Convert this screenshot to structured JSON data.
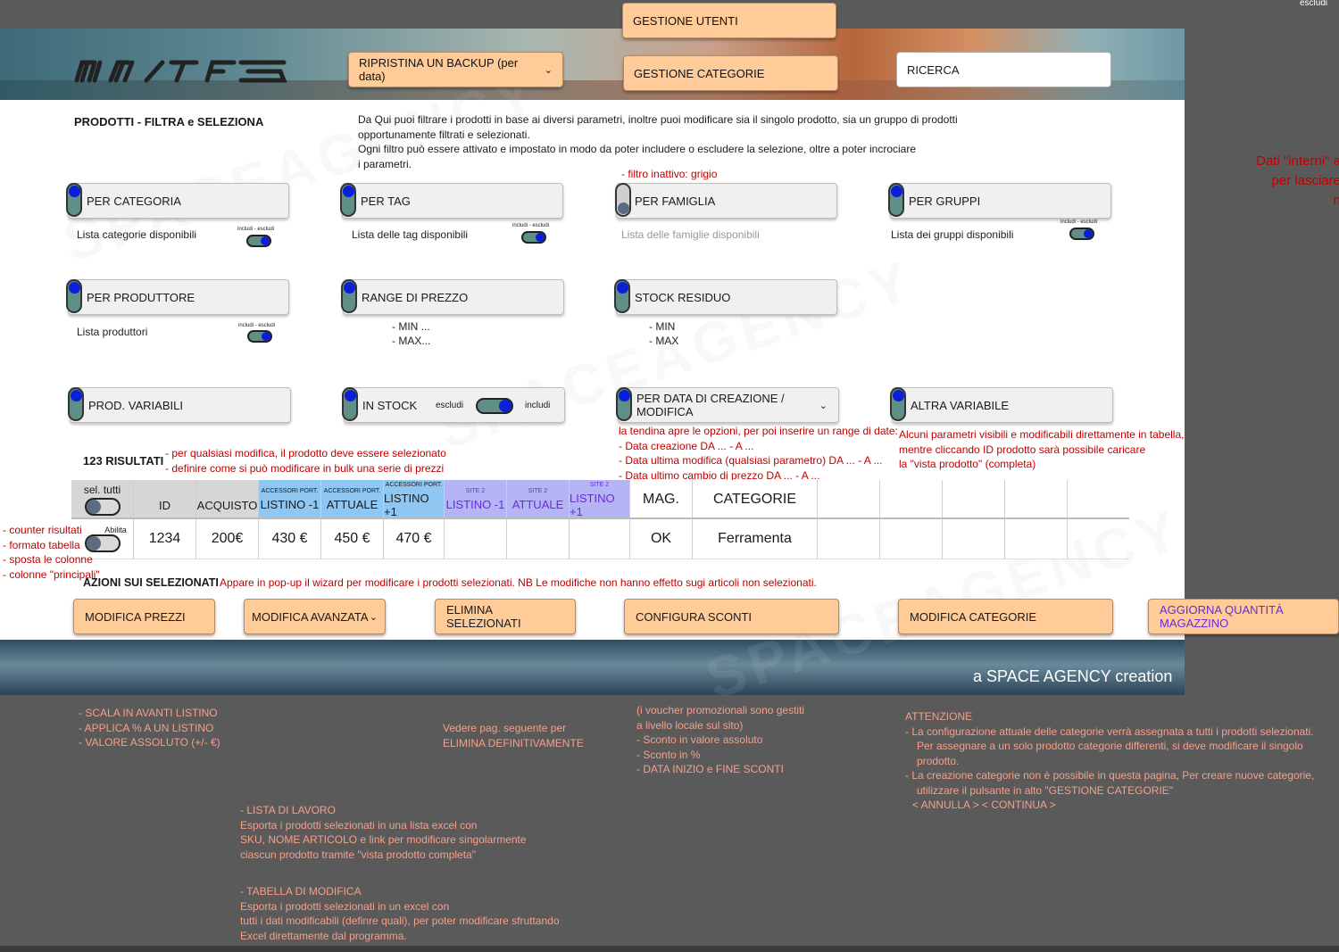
{
  "top_tabs": {
    "gestione_utenti": "GESTIONE UTENTI",
    "ripristina_backup": "RIPRISTINA UN BACKUP (per data)",
    "gestione_categorie": "GESTIONE CATEGORIE",
    "ricerca": "RICERCA"
  },
  "corner": {
    "escludi": "escludi"
  },
  "side_note": {
    "line1": "Dati \"interni\" a",
    "line2": "per lasciare",
    "line3": "n"
  },
  "intro": {
    "title": "PRODOTTI - FILTRA e SELEZIONA",
    "line1": "Da Qui puoi filtrare i prodotti in base ai diversi parametri, inoltre puoi modificare sia il singolo prodotto, sia un gruppo di prodotti",
    "line2": "opportunamente filtrati e selezionati.",
    "line3": "Ogni filtro può essere attivato e impostato in modo da poter includere o escludere la selezione, oltre a poter incrociare",
    "line4": "i parametri."
  },
  "filters": {
    "inactive_note": "filtro inattivo: grigio",
    "include_exclude": "includi - escludi",
    "per_categoria": "PER CATEGORIA",
    "per_categoria_sub": "Lista categorie disponibili",
    "per_tag": "PER TAG",
    "per_tag_sub": "Lista delle tag disponibili",
    "per_famiglia": "PER FAMIGLIA",
    "per_famiglia_sub": "Lista delle famiglie disponibili",
    "per_gruppi": "PER GRUPPI",
    "per_gruppi_sub": "Lista dei gruppi disponibili",
    "per_produttore": "PER PRODUTTORE",
    "per_produttore_sub": "Lista produttori",
    "range_prezzo": "RANGE DI PREZZO",
    "range_min": "MIN ...",
    "range_max": "MAX...",
    "stock_residuo": "STOCK RESIDUO",
    "stock_min": "MIN",
    "stock_max": "MAX",
    "prod_variabili": "PROD. VARIABILI",
    "in_stock": "IN STOCK",
    "in_stock_escludi": "escludi",
    "in_stock_includi": "includi",
    "per_data": "PER DATA DI CREAZIONE / MODIFICA",
    "altra_variabile": "ALTRA VARIABILE"
  },
  "date_note": {
    "line1": "la tendina apre le opzioni, per poi inserire un range di date:",
    "items": [
      "Data creazione  DA ... - A ...",
      "Data ultima modifica (qualsiasi parametro)   DA ... - A ...",
      "Data ultimo cambio di prezzo DA ... - A ..."
    ]
  },
  "table_note": {
    "line1": "Alcuni parametri visibili e modificabili direttamente in tabella,",
    "line2": "mentre cliccando ID prodotto sarà possibile caricare",
    "line3": "la \"vista prodotto\" (completa)"
  },
  "results": {
    "count": "123 RISULTATI",
    "notes": [
      "per qualsiasi modifica, il prodotto deve essere selezionato",
      "definire come si può modificare in bulk una serie di prezzi"
    ]
  },
  "table": {
    "sel_tutti": "sel. tutti",
    "abilita": "Abilita",
    "col_id": "ID",
    "col_acquisto": "ACQUISTO",
    "acc_port": "ACCESSORI PORT.",
    "site2": "SITE 2",
    "listino_minus": "LISTINO -1",
    "attuale": "ATTUALE",
    "listino_plus": "LISTINO +1",
    "col_mag": "MAG.",
    "col_categorie": "CATEGORIE",
    "row": {
      "id": "1234",
      "acquisto": "200€",
      "l_minus": "430 €",
      "attuale": "450 €",
      "l_plus": "470 €",
      "mag": "OK",
      "categorie": "Ferramenta"
    }
  },
  "left_notes": [
    "counter risultati",
    "formato tabella",
    "sposta le colonne",
    "colonne \"principali\""
  ],
  "actions": {
    "title": "AZIONI SUI SELEZIONATI",
    "note": "Appare in pop-up il wizard per modificare i prodotti selezionati. NB Le modifiche non hanno effetto sugi articoli non selezionati.",
    "modifica_prezzi": "MODIFICA PREZZI",
    "modifica_avanzata": "MODIFICA AVANZATA",
    "elimina": "ELIMINA SELEZIONATI",
    "configura_sconti": "CONFIGURA SCONTI",
    "modifica_categorie": "MODIFICA CATEGORIE",
    "aggiorna_quantita": "AGGIORNA QUANTITÀ MAGAZZINO"
  },
  "footer": {
    "credit": "a SPACE AGENCY creation"
  },
  "below": {
    "prezzi": [
      "SCALA IN AVANTI LISTINO",
      "APPLICA % A UN LISTINO",
      "VALORE ASSOLUTO (+/- €)"
    ],
    "elimina": {
      "line1": "Vedere pag. seguente per",
      "line2": "ELIMINA DEFINITIVAMENTE"
    },
    "sconti": {
      "line1": "(i voucher promozionali sono gestiti",
      "line2": "a livello locale sul sito)",
      "items": [
        "Sconto in valore assoluto",
        "Sconto in %",
        "DATA INIZIO e FINE SCONTI"
      ]
    },
    "categorie": {
      "title": "ATTENZIONE",
      "item1a": "La configurazione attuale delle categorie verrà assegnata a tutti i prodotti selezionati.",
      "item1b": "Per assegnare a un solo prodotto categorie differenti, si deve modificare il singolo prodotto.",
      "item2a": "La creazione categorie non è possibile in questa pagina, Per creare nuove categorie,",
      "item2b": "utilizzare il pulsante in alto \"GESTIONE CATEGORIE\"",
      "buttons": "< ANNULLA >    < CONTINUA >"
    },
    "lista": {
      "title": "LISTA DI LAVORO",
      "line1": "Esporta i prodotti selezionati in una lista excel con",
      "line2": "SKU, NOME ARTICOLO e link per modificare  singolarmente",
      "line3": "ciascun  prodotto tramite \"vista prodotto completa\""
    },
    "tabella": {
      "title": "TABELLA DI MODIFICA",
      "line1": "Esporta i prodotti selezionati in un excel con",
      "line2": "tutti i dati modificabili (definre quali), per poter modificare sfruttando",
      "line3": "Excel direttamente dal programma."
    }
  }
}
